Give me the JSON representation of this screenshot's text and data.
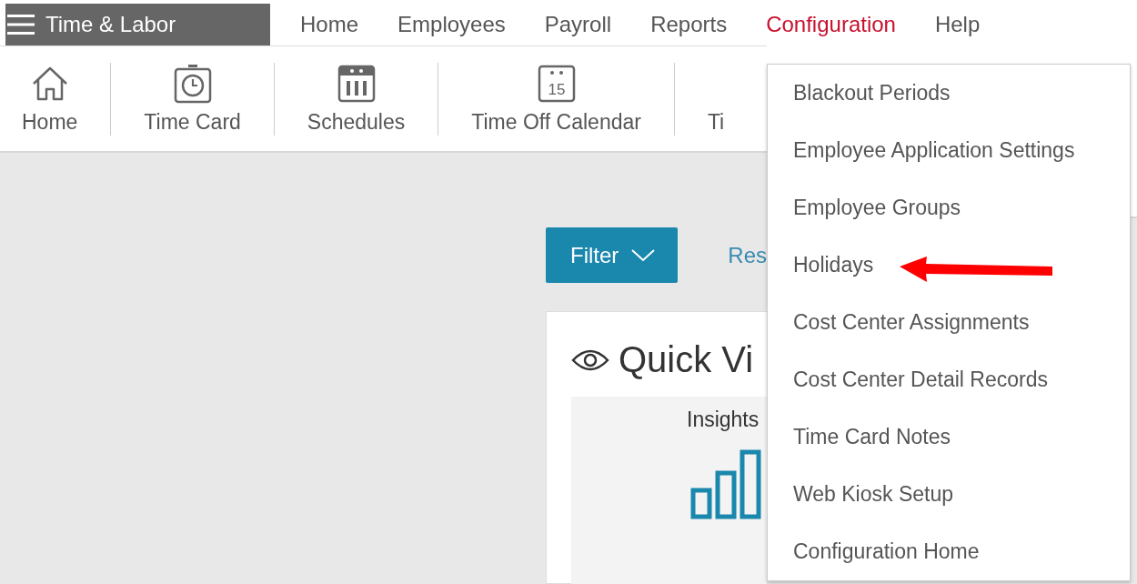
{
  "app_menu": {
    "title": "Time & Labor"
  },
  "nav": [
    {
      "label": "Home",
      "selected": false
    },
    {
      "label": "Employees",
      "selected": false
    },
    {
      "label": "Payroll",
      "selected": false
    },
    {
      "label": "Reports",
      "selected": false
    },
    {
      "label": "Configuration",
      "selected": true
    },
    {
      "label": "Help",
      "selected": false
    }
  ],
  "toolbar": [
    {
      "label": "Home",
      "kind": "home"
    },
    {
      "label": "Time Card",
      "kind": "stopwatch"
    },
    {
      "label": "Schedules",
      "kind": "schedule"
    },
    {
      "label": "Time Off Calendar",
      "kind": "calendar",
      "icon_text": "15"
    },
    {
      "label": "Ti",
      "kind": "hidden"
    }
  ],
  "filter_button": {
    "label": "Filter"
  },
  "reset_link": {
    "label": "Res"
  },
  "quick_view": {
    "title": "Quick Vi",
    "insights": {
      "title": "Insights"
    }
  },
  "dropdown": {
    "items": [
      {
        "label": "Blackout Periods"
      },
      {
        "label": "Employee Application Settings"
      },
      {
        "label": "Employee Groups"
      },
      {
        "label": "Holidays"
      },
      {
        "label": "Cost Center Assignments"
      },
      {
        "label": "Cost Center Detail Records"
      },
      {
        "label": "Time Card Notes"
      },
      {
        "label": "Web Kiosk Setup"
      },
      {
        "label": "Configuration Home"
      }
    ]
  }
}
